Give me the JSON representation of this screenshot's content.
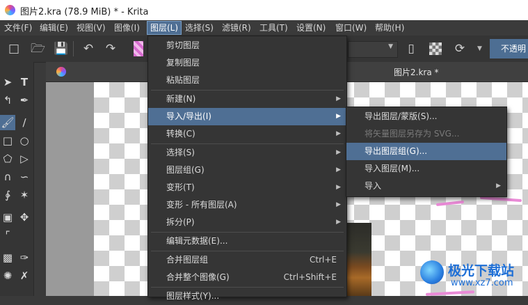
{
  "window": {
    "title": "图片2.kra (78.9 MiB)  * - Krita"
  },
  "menubar": [
    "文件(F)",
    "编辑(E)",
    "视图(V)",
    "图像(I)",
    "图层(L)",
    "选择(S)",
    "滤镜(R)",
    "工具(T)",
    "设置(N)",
    "窗口(W)",
    "帮助(H)"
  ],
  "toolbar": {
    "opacity_label": "不透明"
  },
  "document_tab": "图片2.kra *",
  "layer_menu": {
    "items": [
      {
        "label": "剪切图层"
      },
      {
        "label": "复制图层"
      },
      {
        "label": "粘贴图层"
      },
      {
        "label": "新建(N)",
        "submenu": true
      },
      {
        "label": "导入/导出(I)",
        "submenu": true,
        "highlighted": true
      },
      {
        "label": "转换(C)",
        "submenu": true
      },
      {
        "label": "选择(S)",
        "submenu": true
      },
      {
        "label": "图层组(G)",
        "submenu": true
      },
      {
        "label": "变形(T)",
        "submenu": true
      },
      {
        "label": "变形 - 所有图层(A)",
        "submenu": true
      },
      {
        "label": "拆分(P)",
        "submenu": true
      },
      {
        "label": "编辑元数据(E)..."
      },
      {
        "label": "合并图层组",
        "shortcut": "Ctrl+E"
      },
      {
        "label": "合并整个图像(G)",
        "shortcut": "Ctrl+Shift+E"
      },
      {
        "label": "图层样式(Y)..."
      }
    ]
  },
  "import_export_submenu": {
    "items": [
      {
        "label": "导出图层/蒙版(S)..."
      },
      {
        "label": "将矢量图层另存为 SVG...",
        "disabled": true
      },
      {
        "label": "导出图层组(G)...",
        "highlighted": true
      },
      {
        "label": "导入图层(M)..."
      },
      {
        "label": "导入",
        "submenu": true
      }
    ]
  },
  "watermark": {
    "title": "极光下载站",
    "url": "www.xz7.com"
  },
  "icons": {
    "toolbar": [
      "new-document-icon",
      "open-folder-icon",
      "save-icon",
      "undo-icon",
      "redo-icon",
      "eraser-icon",
      "checker-icon",
      "reload-icon"
    ],
    "tools": [
      "pointer-icon",
      "text-icon",
      "edit-shapes-icon",
      "calligraphy-pen-icon",
      "brush-icon",
      "line-icon",
      "rectangle-icon",
      "ellipse-icon",
      "polygon-icon",
      "polyline-icon",
      "bezier-icon",
      "freehand-path-icon",
      "dynamic-brush-icon",
      "multibrush-icon",
      "transform-icon",
      "move-icon",
      "crop-icon",
      "gradient-icon",
      "color-picker-icon",
      "smart-patch-icon"
    ]
  }
}
